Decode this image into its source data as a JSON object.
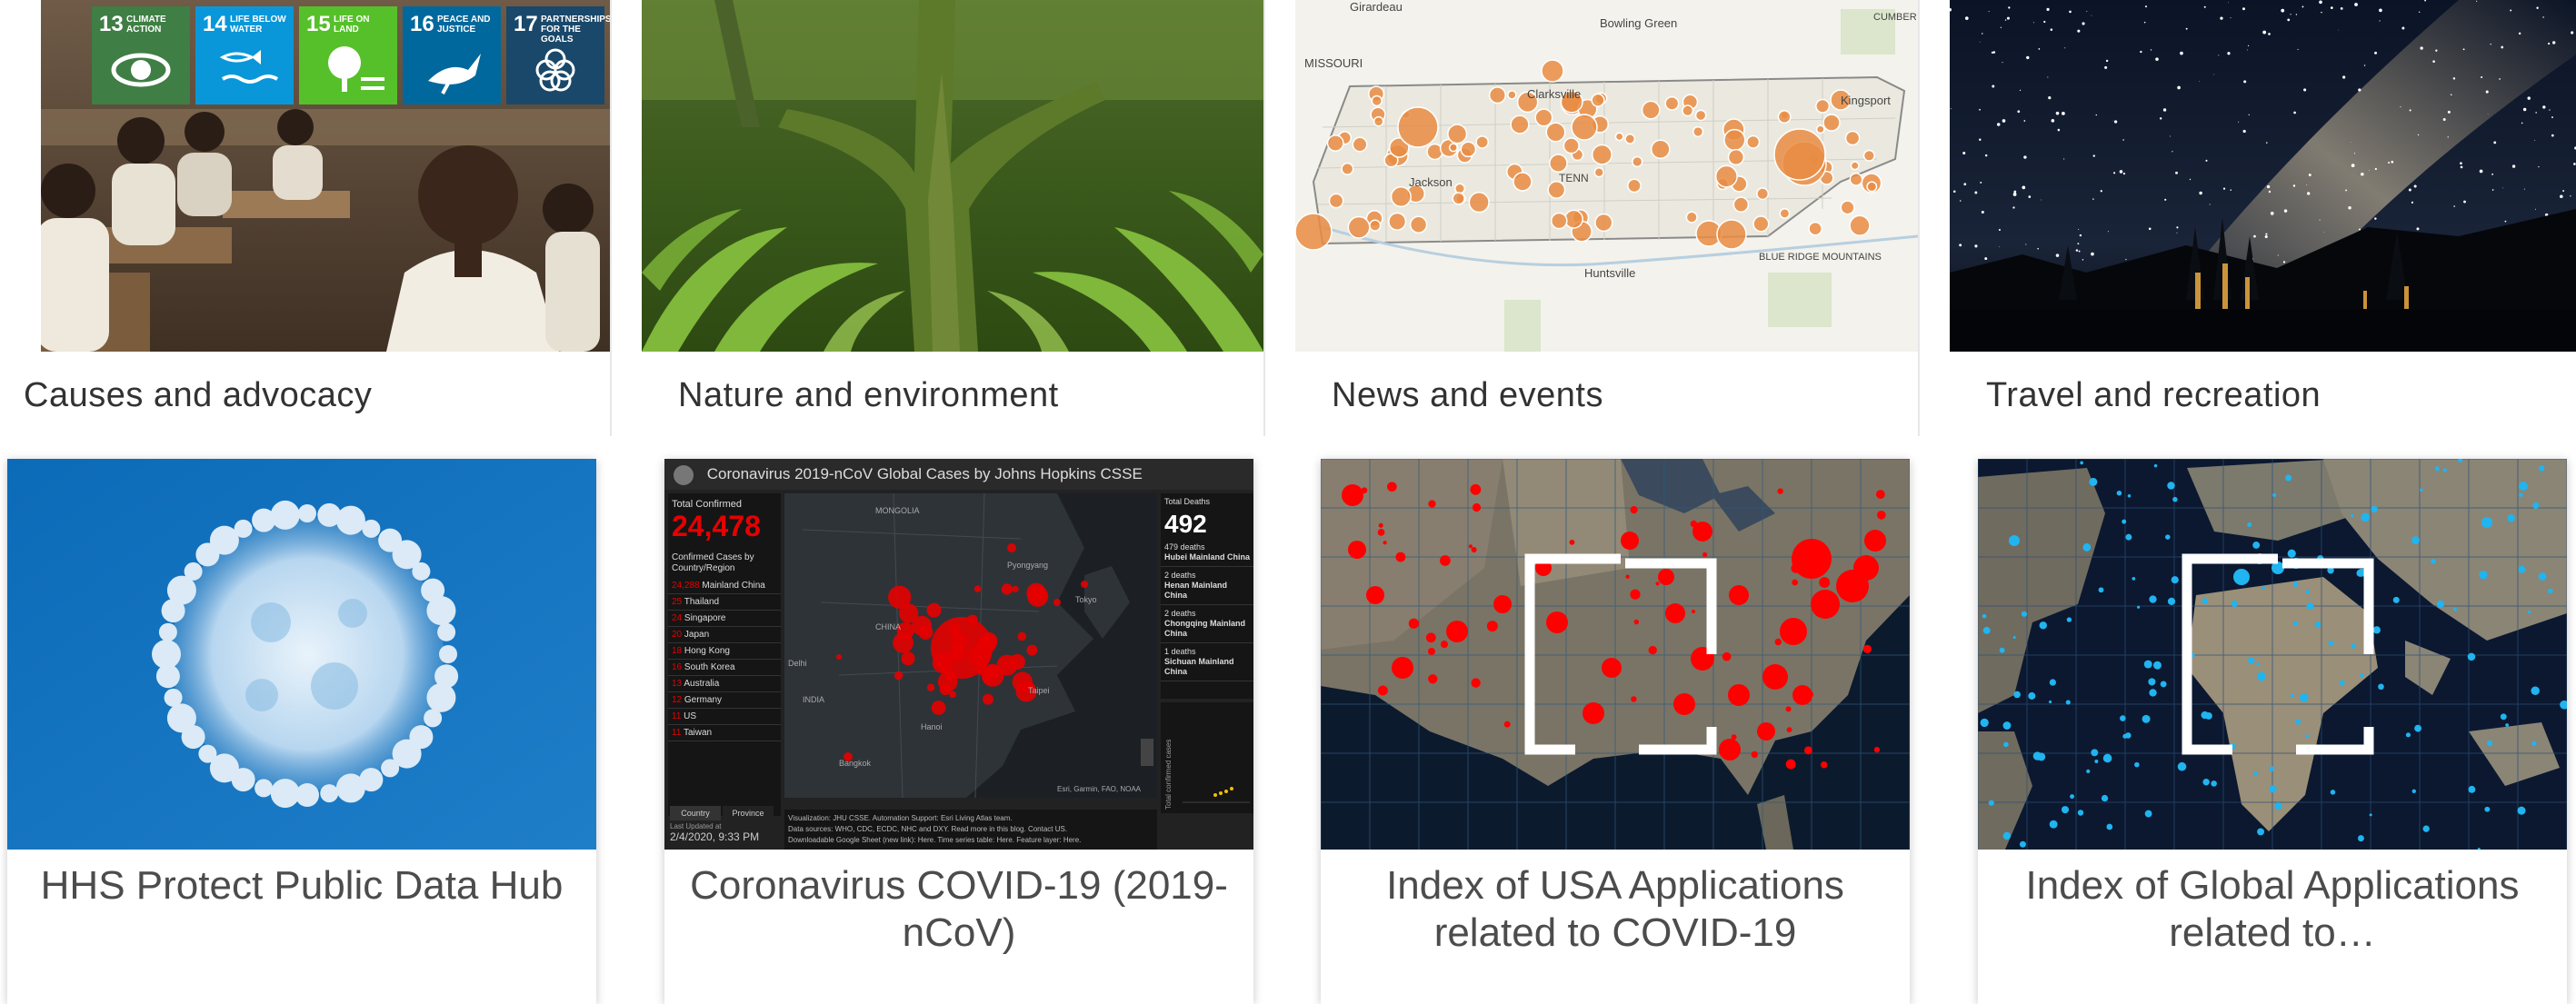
{
  "categories": [
    {
      "label": "Causes and advocacy",
      "icon": "sdg-classroom-image"
    },
    {
      "label": "Nature and environment",
      "icon": "mossy-tree-image"
    },
    {
      "label": "News and events",
      "icon": "tennessee-map-image"
    },
    {
      "label": "Travel and recreation",
      "icon": "milky-way-image"
    }
  ],
  "sdg_goals": [
    {
      "num": "13",
      "text": "CLIMATE ACTION",
      "color": "#3f7e44"
    },
    {
      "num": "14",
      "text": "LIFE BELOW WATER",
      "color": "#0a97d9"
    },
    {
      "num": "15",
      "text": "LIFE ON LAND",
      "color": "#56c02b"
    },
    {
      "num": "16",
      "text": "PEACE AND JUSTICE",
      "color": "#00689d"
    },
    {
      "num": "17",
      "text": "PARTNERSHIPS FOR THE GOALS",
      "color": "#19486a"
    }
  ],
  "map_labels": {
    "missouri": "MISSOURI",
    "girardeau": "Girardeau",
    "bowling_green": "Bowling Green",
    "huntsville": "Huntsville",
    "blue_ridge": "BLUE RIDGE MOUNTAINS",
    "jackson": "Jackson",
    "tenn": "TENN",
    "kingsport": "Kingsport",
    "clarksville": "Clarksville",
    "cumberland": "CUMBER"
  },
  "cards": [
    {
      "title": "HHS Protect Public Data Hub",
      "icon": "virus-image"
    },
    {
      "title": "Coronavirus COVID-19 (2019-nCoV)",
      "icon": "dashboard-image"
    },
    {
      "title": "Index of USA Applications related to COVID-19",
      "icon": "usa-map-image"
    },
    {
      "title": "Index of Global Applications related to…",
      "icon": "world-map-image"
    }
  ],
  "dashboard": {
    "header": "Coronavirus 2019-nCoV Global Cases by Johns Hopkins CSSE",
    "total_confirmed_label": "Total Confirmed",
    "total_confirmed": "24,478",
    "by_region_label": "Confirmed Cases by Country/Region",
    "regions": [
      {
        "count": "24,288",
        "name": "Mainland China"
      },
      {
        "count": "25",
        "name": "Thailand"
      },
      {
        "count": "24",
        "name": "Singapore"
      },
      {
        "count": "20",
        "name": "Japan"
      },
      {
        "count": "18",
        "name": "Hong Kong"
      },
      {
        "count": "16",
        "name": "South Korea"
      },
      {
        "count": "13",
        "name": "Australia"
      },
      {
        "count": "12",
        "name": "Germany"
      },
      {
        "count": "11",
        "name": "US"
      },
      {
        "count": "11",
        "name": "Taiwan"
      }
    ],
    "tab_country": "Country",
    "tab_province": "Province",
    "last_updated_label": "Last Updated at",
    "last_updated": "2/4/2020, 9:33 PM",
    "total_deaths_label": "Total Deaths",
    "total_deaths": "492",
    "death_items": [
      {
        "count": "479 deaths",
        "place": "Hubei Mainland China"
      },
      {
        "count": "2 deaths",
        "place": "Henan Mainland China"
      },
      {
        "count": "2 deaths",
        "place": "Chongqing Mainland China"
      },
      {
        "count": "1 deaths",
        "place": "Sichuan Mainland China"
      }
    ],
    "map_label_mongolia": "MONGOLIA",
    "map_label_china": "CHINA",
    "map_label_india": "INDIA",
    "map_label_pyongyang": "Pyongyang",
    "map_label_tokyo": "Tokyo",
    "map_label_taipei": "Taipei",
    "map_label_bangkok": "Bangkok",
    "map_label_delhi": "Delhi",
    "map_label_hanoi": "Hanoi",
    "attribution": "Esri, Garmin, FAO, NOAA",
    "footer_line1": "Visualization: JHU CSSE. Automation Support: Esri Living Atlas team.",
    "footer_line2": "Data sources: WHO, CDC, ECDC, NHC and DXY. Read more in this blog. Contact US.",
    "footer_line3": "Downloadable Google Sheet (new link): Here. Time series table: Here. Feature layer: Here.",
    "side_axis": "Total confirmed cases"
  },
  "colors": {
    "covid_red": "#e60000",
    "map_orange": "#e98c43",
    "global_cyan": "#20b4f0",
    "title_text": "#4c4c4c",
    "label_text": "#323232"
  }
}
